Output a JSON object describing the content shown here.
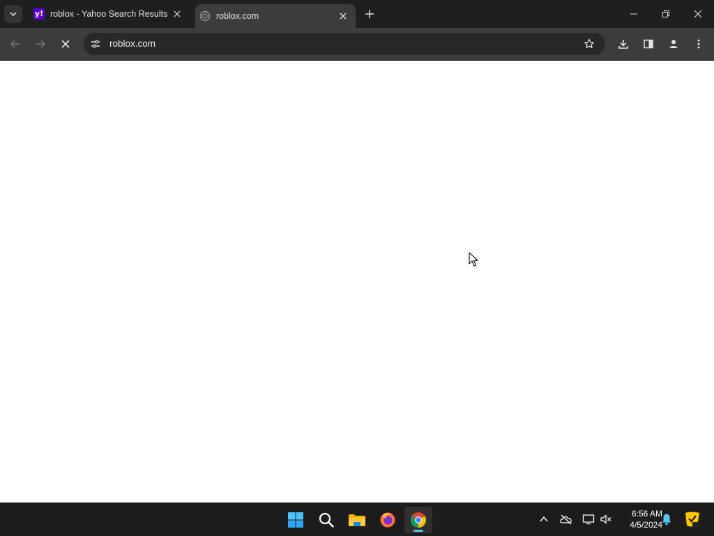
{
  "browser": {
    "tabs": [
      {
        "title": "roblox - Yahoo Search Results",
        "favicon": "yahoo-favicon",
        "favicon_glyph": "y!",
        "active": false
      },
      {
        "title": "roblox.com",
        "favicon": "loading-globe-icon",
        "active": true
      }
    ],
    "omnibox": {
      "url": "roblox.com"
    },
    "toolbar_icons": [
      "back-arrow-icon",
      "forward-arrow-icon",
      "stop-loading-icon",
      "site-info-icon",
      "bookmark-star-icon",
      "download-icon",
      "side-panel-icon",
      "profile-icon",
      "menu-kebab-icon"
    ],
    "window_controls": [
      "minimize-icon",
      "restore-icon",
      "close-icon"
    ]
  },
  "taskbar": {
    "pinned": [
      "windows-start-icon",
      "search-icon",
      "file-explorer-icon",
      "firefox-icon",
      "chrome-icon"
    ],
    "active_app": "chrome-icon",
    "tray": [
      "chevron-up-icon",
      "onedrive-offline-icon",
      "network-icon",
      "volume-muted-icon",
      "notification-bell-icon",
      "norton-icon"
    ],
    "clock": {
      "time": "6:56 AM",
      "date": "4/5/2024"
    }
  },
  "colors": {
    "tabstrip": "#1f1f1f",
    "toolbar": "#3c3c3c",
    "omnibox": "#282828",
    "taskbar": "#1c1c1c",
    "yahoo_purple": "#6001d2",
    "accent_blue": "#5cc4f0"
  }
}
